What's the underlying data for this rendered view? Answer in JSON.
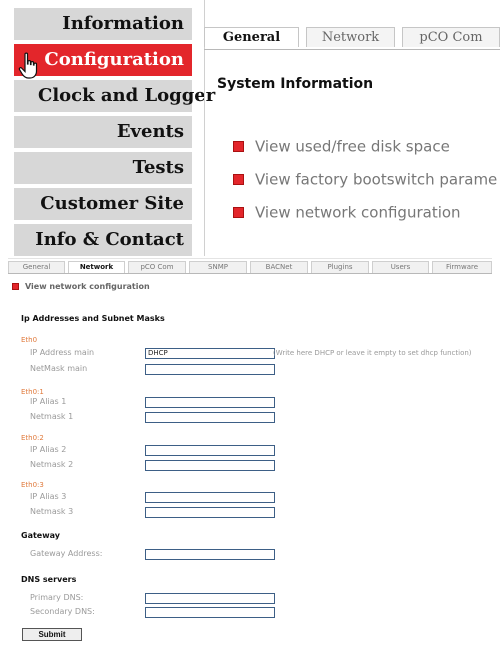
{
  "menu": {
    "items": [
      {
        "label": "Information"
      },
      {
        "label": "Configuration"
      },
      {
        "label": "Clock and Logger"
      },
      {
        "label": "Events"
      },
      {
        "label": "Tests"
      },
      {
        "label": "Customer Site"
      },
      {
        "label": "Info & Contact"
      }
    ],
    "active_color": "#e3262b"
  },
  "top_tabs": [
    {
      "label": "General"
    },
    {
      "label": "Network"
    },
    {
      "label": "pCO Com"
    }
  ],
  "system_info": {
    "heading": "System Information",
    "links": [
      {
        "label": "View used/free disk space"
      },
      {
        "label": "View factory bootswitch parame"
      },
      {
        "label": "View network configuration"
      }
    ]
  },
  "network_page": {
    "tabs": [
      {
        "label": "General"
      },
      {
        "label": "Network"
      },
      {
        "label": "pCO Com"
      },
      {
        "label": "SNMP"
      },
      {
        "label": "BACNet"
      },
      {
        "label": "Plugins"
      },
      {
        "label": "Users"
      },
      {
        "label": "Firmware"
      }
    ],
    "link": "View network configuration",
    "section_ip": "Ip Addresses and Subnet Masks",
    "eth0": {
      "label": "Eth0",
      "ip_label": "IP Address main",
      "ip_value": "DHCP",
      "ip_hint": "(Write here DHCP or leave it empty to set dhcp function)",
      "mask_label": "NetMask main"
    },
    "eth0_1": {
      "label": "Eth0:1",
      "ip_label": "IP Alias 1",
      "mask_label": "Netmask 1"
    },
    "eth0_2": {
      "label": "Eth0:2",
      "ip_label": "IP Alias 2",
      "mask_label": "Netmask 2"
    },
    "eth0_3": {
      "label": "Eth0:3",
      "ip_label": "IP Alias 3",
      "mask_label": "Netmask 3"
    },
    "gateway": {
      "heading": "Gateway",
      "label": "Gateway Address:"
    },
    "dns": {
      "heading": "DNS servers",
      "primary_label": "Primary DNS:",
      "secondary_label": "Secondary DNS:"
    },
    "submit_label": "Submit"
  }
}
